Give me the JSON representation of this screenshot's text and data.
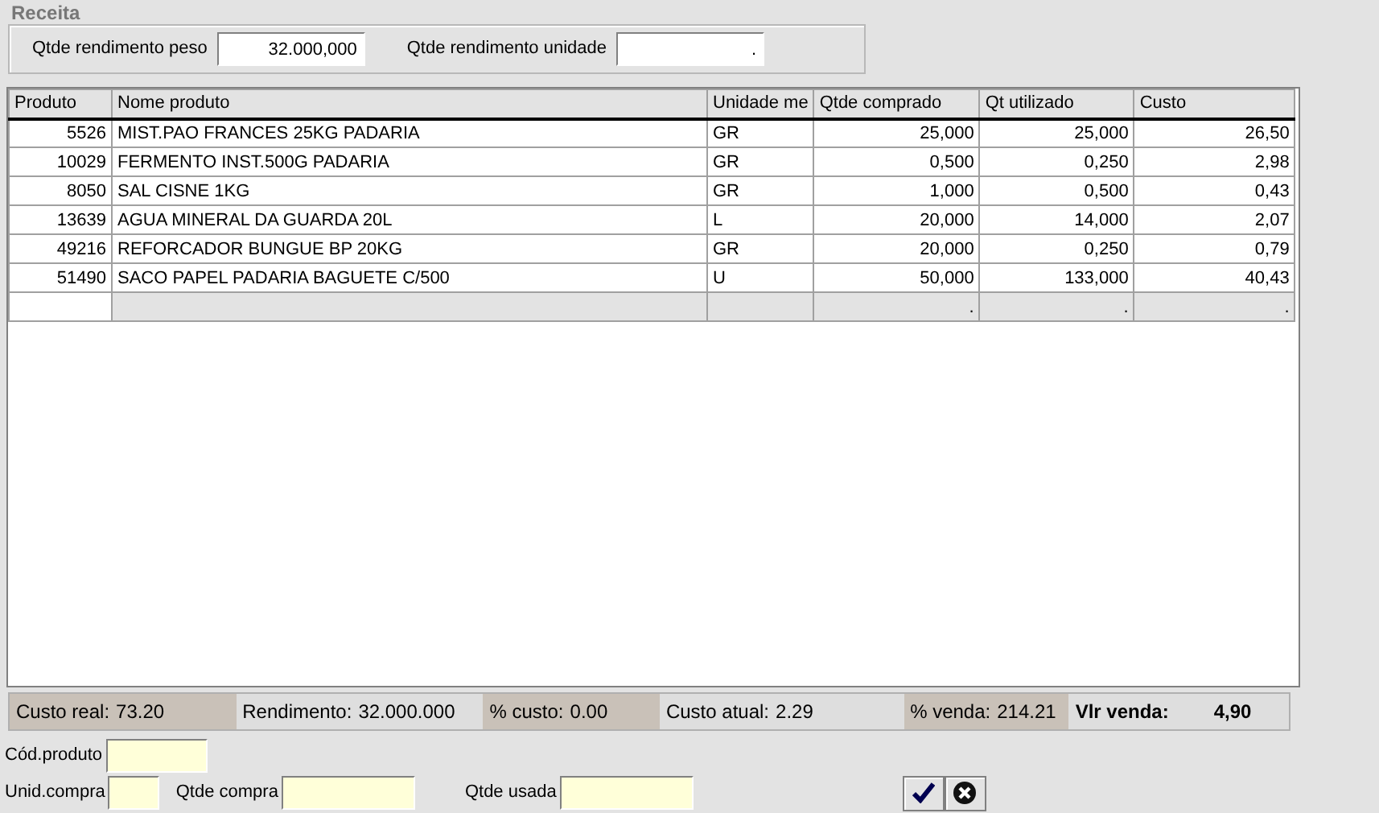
{
  "title": "Receita",
  "header_fields": [
    {
      "label": "Qtde rendimento peso",
      "value": "32.000,000"
    },
    {
      "label": "Qtde rendimento unidade",
      "value": "."
    }
  ],
  "table": {
    "columns": [
      "Produto",
      "Nome produto",
      "Unidade me",
      "Qtde comprado",
      "Qt utilizado",
      "Custo"
    ],
    "rows": [
      [
        "5526",
        "MIST.PAO FRANCES 25KG PADARIA",
        "GR",
        "25,000",
        "25,000",
        "26,50"
      ],
      [
        "10029",
        "FERMENTO INST.500G PADARIA",
        "GR",
        "0,500",
        "0,250",
        "2,98"
      ],
      [
        "8050",
        "SAL CISNE 1KG",
        "GR",
        "1,000",
        "0,500",
        "0,43"
      ],
      [
        "13639",
        "AGUA MINERAL DA GUARDA 20L",
        "L",
        "20,000",
        "14,000",
        "2,07"
      ],
      [
        "49216",
        "REFORCADOR BUNGUE BP 20KG",
        "GR",
        "20,000",
        "0,250",
        "0,79"
      ],
      [
        "51490",
        "SACO PAPEL PADARIA BAGUETE C/500",
        "U",
        "50,000",
        "133,000",
        "40,43"
      ]
    ],
    "new_row": {
      "trailing_cells": [
        ".",
        ".",
        "."
      ]
    }
  },
  "summary": [
    {
      "label": "Custo real:",
      "value": "73.20",
      "shaded": true,
      "bold": false
    },
    {
      "label": "Rendimento:",
      "value": "32.000.000",
      "shaded": false,
      "bold": false
    },
    {
      "label": "% custo:",
      "value": "0.00",
      "shaded": true,
      "bold": false
    },
    {
      "label": "Custo atual:",
      "value": "2.29",
      "shaded": false,
      "bold": false
    },
    {
      "label": "% venda:",
      "value": "214.21",
      "shaded": true,
      "bold": false
    },
    {
      "label": "Vlr venda:",
      "value": "4,90",
      "shaded": false,
      "bold": true
    }
  ],
  "entry_fields": [
    {
      "label": "Cód.produto"
    },
    {
      "label": "Unid.compra"
    },
    {
      "label": "Qtde compra"
    },
    {
      "label": "Qtde usada"
    }
  ],
  "buttons": [
    {
      "kind": "confirm"
    },
    {
      "kind": "cancel"
    }
  ]
}
